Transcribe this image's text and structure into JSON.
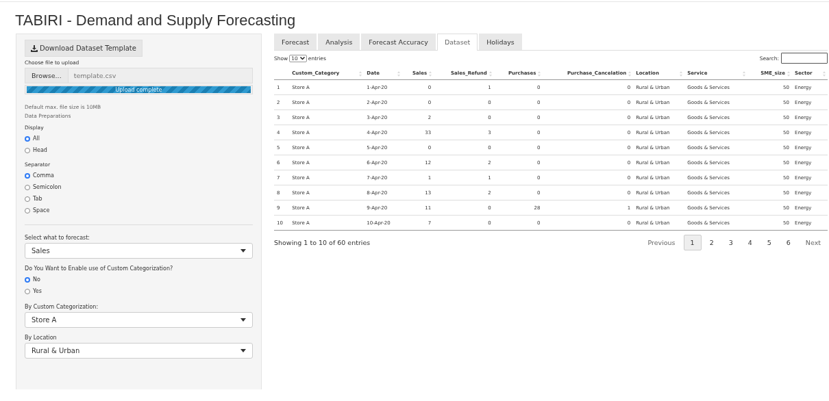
{
  "title": "TABIRI - Demand and Supply Forecasting",
  "sidebar": {
    "download_button": "Download Dataset Template",
    "file_label": "Choose file to upload",
    "browse_button": "Browse...",
    "file_name": "template.csv",
    "upload_progress": {
      "label": "Upload complete",
      "level": 1
    },
    "note": "Default max. file size is 10MB",
    "section": "Data Preparations",
    "radio_groups": [
      {
        "label": "Display",
        "options": [
          {
            "label": "All",
            "selected": true
          },
          {
            "label": "Head",
            "selected": false
          }
        ]
      },
      {
        "label": "Separator",
        "options": [
          {
            "label": "Comma",
            "selected": true
          },
          {
            "label": "Semicolon",
            "selected": false
          },
          {
            "label": "Tab",
            "selected": false
          },
          {
            "label": "Space",
            "selected": false
          }
        ]
      }
    ],
    "controls": [
      {
        "kind": "select",
        "label": "Select what to forecast:",
        "value": "Sales"
      },
      {
        "kind": "radio",
        "label": "Do You Want to Enable use of Custom Categorization?",
        "options": [
          {
            "label": "No",
            "selected": true
          },
          {
            "label": "Yes",
            "selected": false
          }
        ]
      },
      {
        "kind": "select",
        "label": "By Custom Categorization:",
        "value": "Store A"
      },
      {
        "kind": "select",
        "label": "By Location",
        "value": "Rural & Urban"
      }
    ]
  },
  "tabs": [
    {
      "label": "Forecast",
      "selected": false
    },
    {
      "label": "Analysis",
      "selected": false
    },
    {
      "label": "Forecast Accuracy",
      "selected": false
    },
    {
      "label": "Dataset",
      "selected": true
    },
    {
      "label": "Holidays",
      "selected": false
    }
  ],
  "table": {
    "show_label": "Show",
    "page_size": "10",
    "entries_label": "entries",
    "search_label": "Search:",
    "columns": [
      {
        "kind": "index"
      },
      {
        "label": "Custom_Category",
        "kind": "text"
      },
      {
        "label": "Date",
        "kind": "text"
      },
      {
        "label": "Sales",
        "kind": "number"
      },
      {
        "label": "Sales_Refund",
        "kind": "number"
      },
      {
        "label": "Purchases",
        "kind": "number"
      },
      {
        "label": "Purchase_Cancelation",
        "kind": "number"
      },
      {
        "label": "Location",
        "kind": "text"
      },
      {
        "label": "Service",
        "kind": "text"
      },
      {
        "label": "SME_size",
        "kind": "number"
      },
      {
        "label": "Sector",
        "kind": "text"
      }
    ],
    "rows": [
      [
        "1",
        "Store A",
        "1-Apr-20",
        "0",
        "1",
        "0",
        "0",
        "Rural & Urban",
        "Goods & Services",
        "50",
        "Energy"
      ],
      [
        "2",
        "Store A",
        "2-Apr-20",
        "0",
        "0",
        "0",
        "0",
        "Rural & Urban",
        "Goods & Services",
        "50",
        "Energy"
      ],
      [
        "3",
        "Store A",
        "3-Apr-20",
        "2",
        "0",
        "0",
        "0",
        "Rural & Urban",
        "Goods & Services",
        "50",
        "Energy"
      ],
      [
        "4",
        "Store A",
        "4-Apr-20",
        "33",
        "3",
        "0",
        "0",
        "Rural & Urban",
        "Goods & Services",
        "50",
        "Energy"
      ],
      [
        "5",
        "Store A",
        "5-Apr-20",
        "0",
        "0",
        "0",
        "0",
        "Rural & Urban",
        "Goods & Services",
        "50",
        "Energy"
      ],
      [
        "6",
        "Store A",
        "6-Apr-20",
        "12",
        "2",
        "0",
        "0",
        "Rural & Urban",
        "Goods & Services",
        "50",
        "Energy"
      ],
      [
        "7",
        "Store A",
        "7-Apr-20",
        "1",
        "1",
        "0",
        "0",
        "Rural & Urban",
        "Goods & Services",
        "50",
        "Energy"
      ],
      [
        "8",
        "Store A",
        "8-Apr-20",
        "13",
        "2",
        "0",
        "0",
        "Rural & Urban",
        "Goods & Services",
        "50",
        "Energy"
      ],
      [
        "9",
        "Store A",
        "9-Apr-20",
        "11",
        "0",
        "28",
        "1",
        "Rural & Urban",
        "Goods & Services",
        "50",
        "Energy"
      ],
      [
        "10",
        "Store A",
        "10-Apr-20",
        "7",
        "0",
        "0",
        "0",
        "Rural & Urban",
        "Goods & Services",
        "50",
        "Energy"
      ]
    ],
    "info": "Showing 1 to 10 of 60 entries",
    "pagination": [
      {
        "label": "Previous",
        "kind": "nav",
        "selected": false
      },
      {
        "label": "1",
        "kind": "page",
        "selected": true
      },
      {
        "label": "2",
        "kind": "page",
        "selected": false
      },
      {
        "label": "3",
        "kind": "page",
        "selected": false
      },
      {
        "label": "4",
        "kind": "page",
        "selected": false
      },
      {
        "label": "5",
        "kind": "page",
        "selected": false
      },
      {
        "label": "6",
        "kind": "page",
        "selected": false
      },
      {
        "label": "Next",
        "kind": "nav",
        "selected": false
      }
    ]
  }
}
